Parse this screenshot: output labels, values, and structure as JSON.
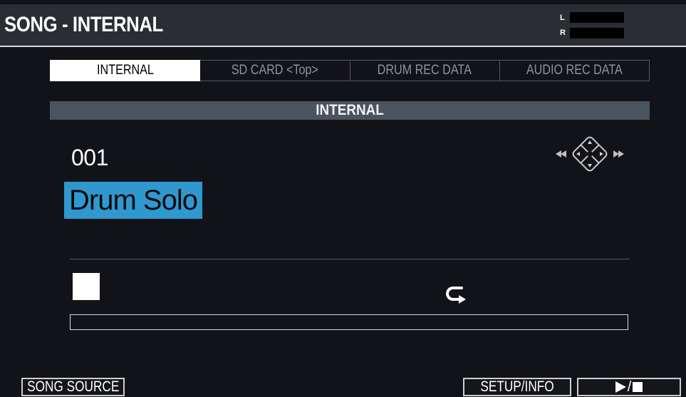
{
  "header": {
    "title": "SONG - INTERNAL",
    "meter": {
      "left_label": "L",
      "right_label": "R"
    }
  },
  "tabs": [
    {
      "label": "INTERNAL",
      "active": true
    },
    {
      "label": "SD CARD <Top>",
      "active": false
    },
    {
      "label": "DRUM REC DATA",
      "active": false
    },
    {
      "label": "AUDIO REC DATA",
      "active": false
    }
  ],
  "section": {
    "title": "INTERNAL"
  },
  "song": {
    "number": "001",
    "name": "Drum Solo",
    "highlight_color": "#2f98cf"
  },
  "cursor_icon": "cursor-dpad-icon",
  "transport": {
    "state_icon": "stop-icon",
    "loop_icon": "loop-icon",
    "progress": 0
  },
  "footer": {
    "song_source": "SONG SOURCE",
    "setup_info": "SETUP/INFO",
    "play_stop_icon": "play-stop-icon"
  }
}
